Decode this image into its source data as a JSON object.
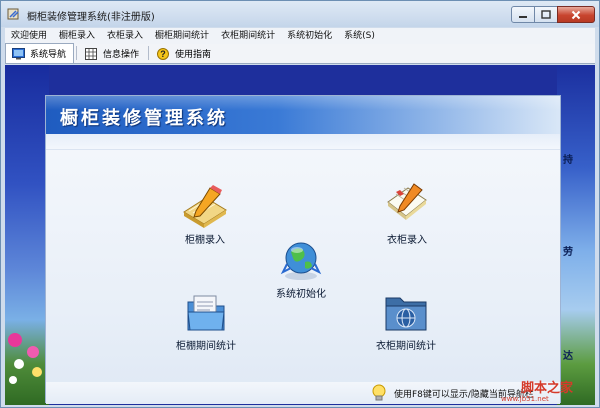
{
  "window": {
    "title": "橱柜装修管理系统(非注册版)"
  },
  "menu": [
    "欢迎使用",
    "橱柜录入",
    "衣柜录入",
    "橱柜期间统计",
    "衣柜期间统计",
    "系统初始化",
    "系统(S)"
  ],
  "toolbar": [
    {
      "label": "系统导航",
      "icon": "nav-icon",
      "active": true
    },
    {
      "label": "信息操作",
      "icon": "grid-icon",
      "active": false
    },
    {
      "label": "使用指南",
      "icon": "help-icon",
      "active": false
    }
  ],
  "panel": {
    "title": "橱柜装修管理系统",
    "items": [
      {
        "label": "柜棚录入",
        "icon": "notebook-pencil-icon"
      },
      {
        "label": "衣柜录入",
        "icon": "notepad-pencil-icon"
      },
      {
        "label": "系统初始化",
        "icon": "globe-network-icon"
      },
      {
        "label": "柜棚期间统计",
        "icon": "folder-doc-icon"
      },
      {
        "label": "衣柜期间统计",
        "icon": "folder-globe-icon"
      }
    ],
    "hint": "使用F8键可以显示/隐藏当前导航栏"
  },
  "edge_text": [
    "持",
    "劳",
    "达"
  ],
  "watermark": {
    "main": "脚本之家",
    "sub": "www.jb51.net"
  },
  "colors": {
    "header_blue": "#2a6ad0",
    "close_red": "#c8452f",
    "panel_bg": "#eef3fa"
  }
}
